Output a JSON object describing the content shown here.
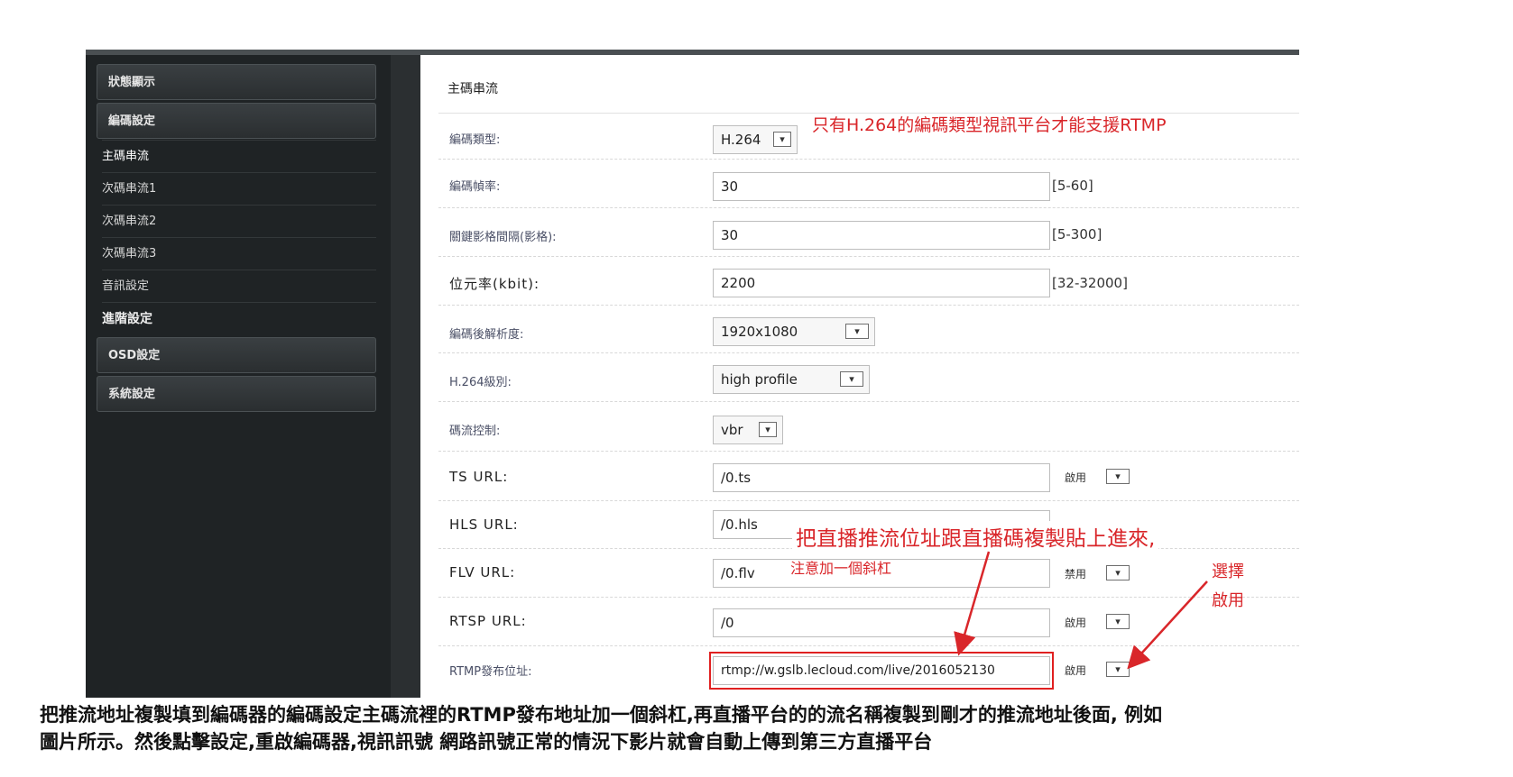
{
  "sidebar": {
    "groups": [
      {
        "label": "狀態顯示"
      },
      {
        "label": "編碼設定"
      }
    ],
    "subitems": [
      {
        "label": "主碼串流"
      },
      {
        "label": "次碼串流1"
      },
      {
        "label": "次碼串流2"
      },
      {
        "label": "次碼串流3"
      },
      {
        "label": "音訊設定"
      },
      {
        "label": "進階設定"
      }
    ],
    "groups_bottom": [
      {
        "label": "OSD設定"
      },
      {
        "label": "系統設定"
      }
    ]
  },
  "main": {
    "section_title": "主碼串流",
    "rows": [
      {
        "label": "編碼類型:",
        "value": "H.264"
      },
      {
        "label": "編碼幀率:",
        "value": "30",
        "range": "[5-60]"
      },
      {
        "label": "關鍵影格間隔(影格):",
        "value": "30",
        "range": "[5-300]"
      },
      {
        "label": "位元率(kbit):",
        "value": "2200",
        "range": "[32-32000]"
      },
      {
        "label": "編碼後解析度:",
        "value": "1920x1080"
      },
      {
        "label": "H.264級別:",
        "value": "high profile"
      },
      {
        "label": "碼流控制:",
        "value": "vbr"
      },
      {
        "label": "TS URL:",
        "value": "/0.ts",
        "toggle": "啟用"
      },
      {
        "label": "HLS URL:",
        "value": "/0.hls"
      },
      {
        "label": "FLV URL:",
        "value": "/0.flv",
        "toggle": "禁用"
      },
      {
        "label": "RTSP URL:",
        "value": "/0",
        "toggle": "啟用"
      },
      {
        "label": "RTMP發布位址:",
        "value": "rtmp://w.gslb.lecloud.com/live/2016052130",
        "toggle": "啟用"
      }
    ]
  },
  "annotations": {
    "h264_note": "只有H.264的編碼類型視訊平台才能支援RTMP",
    "paste_note": "把直播推流位址跟直播碼複製貼上進來,",
    "slash_note": "注意加一個斜杠",
    "select_note_line1": "選擇",
    "select_note_line2": "啟用",
    "color": "#d9262a"
  },
  "caption": {
    "line1": "把推流地址複製填到編碼器的編碼設定主碼流裡的RTMP發布地址加一個斜杠,再直播平台的的流名稱複製到剛才的推流地址後面, 例如",
    "line2": "圖片所示。然後點擊設定,重啟編碼器,視訊訊號 網路訊號正常的情況下影片就會自動上傳到第三方直播平台"
  }
}
